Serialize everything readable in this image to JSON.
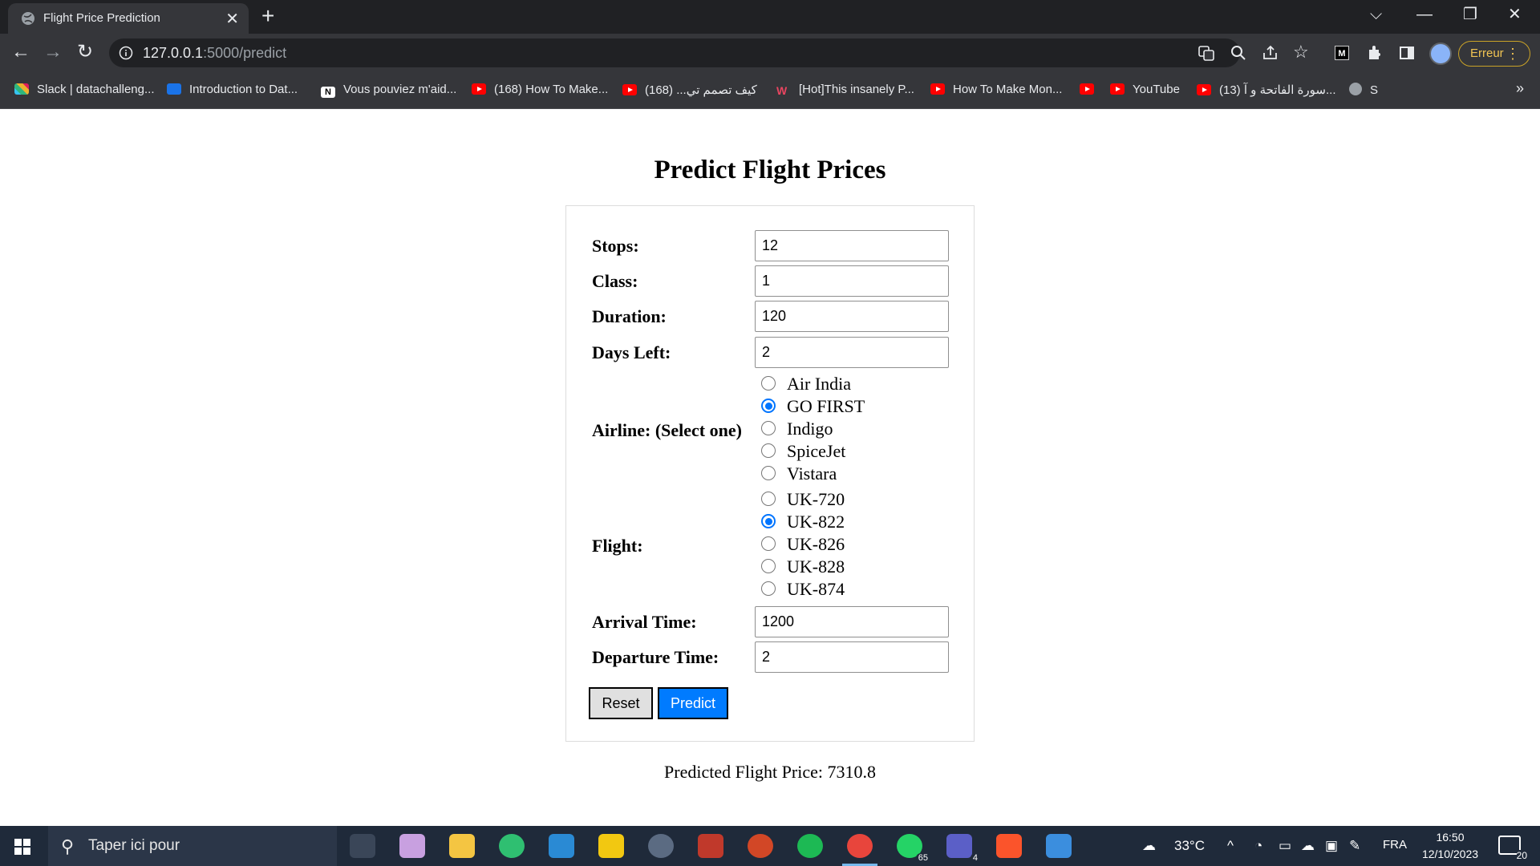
{
  "browser": {
    "tab_title": "Flight Price Prediction",
    "url_host": "127.0.0.1",
    "url_path": ":5000/predict",
    "profile_status": "Erreur"
  },
  "bookmarks": [
    {
      "label": "Slack | datachalleng...",
      "icon": "slack-icon"
    },
    {
      "label": "Introduction to Dat...",
      "icon": "bookmark-icon"
    },
    {
      "label": "Vous pouviez m'aid...",
      "icon": "notion-icon"
    },
    {
      "label": "(168) How To Make...",
      "icon": "youtube-icon"
    },
    {
      "label": "كيف تصمم تي... (168)",
      "icon": "youtube-icon"
    },
    {
      "label": "[Hot]This insanely P...",
      "icon": "wish-icon"
    },
    {
      "label": "How To Make Mon...",
      "icon": "youtube-icon"
    },
    {
      "label": "",
      "icon": "youtube-icon"
    },
    {
      "label": "YouTube",
      "icon": "youtube-icon"
    },
    {
      "label": "(13) سورة الفاتحة و آ...",
      "icon": "youtube-icon"
    },
    {
      "label": "S",
      "icon": "globe-icon"
    }
  ],
  "page": {
    "heading": "Predict Flight Prices",
    "fields": {
      "stops": {
        "label": "Stops:",
        "value": "12"
      },
      "class": {
        "label": "Class:",
        "value": "1"
      },
      "duration": {
        "label": "Duration:",
        "value": "120"
      },
      "days_left": {
        "label": "Days Left:",
        "value": "2"
      },
      "arrival_time": {
        "label": "Arrival Time:",
        "value": "1200"
      },
      "departure_time": {
        "label": "Departure Time:",
        "value": "2"
      }
    },
    "airline": {
      "label": "Airline: (Select one)",
      "options": [
        "Air India",
        "GO FIRST",
        "Indigo",
        "SpiceJet",
        "Vistara"
      ],
      "selected": "GO FIRST"
    },
    "flight": {
      "label": "Flight:",
      "options": [
        "UK-720",
        "UK-822",
        "UK-826",
        "UK-828",
        "UK-874"
      ],
      "selected": "UK-822"
    },
    "buttons": {
      "reset": "Reset",
      "predict": "Predict"
    },
    "result": "Predicted Flight Price: 7310.8"
  },
  "taskbar": {
    "search_placeholder": "Taper ici pour",
    "weather": "33°C",
    "language": "FRA",
    "time": "16:50",
    "date": "12/10/2023",
    "whatsapp_badge": "65",
    "teams_badge": "4",
    "notifications_count": "20"
  },
  "colors": {
    "accent": "#007bff",
    "radio": "#0075ff",
    "chrome_dark": "#202124",
    "chrome": "#35363a"
  }
}
